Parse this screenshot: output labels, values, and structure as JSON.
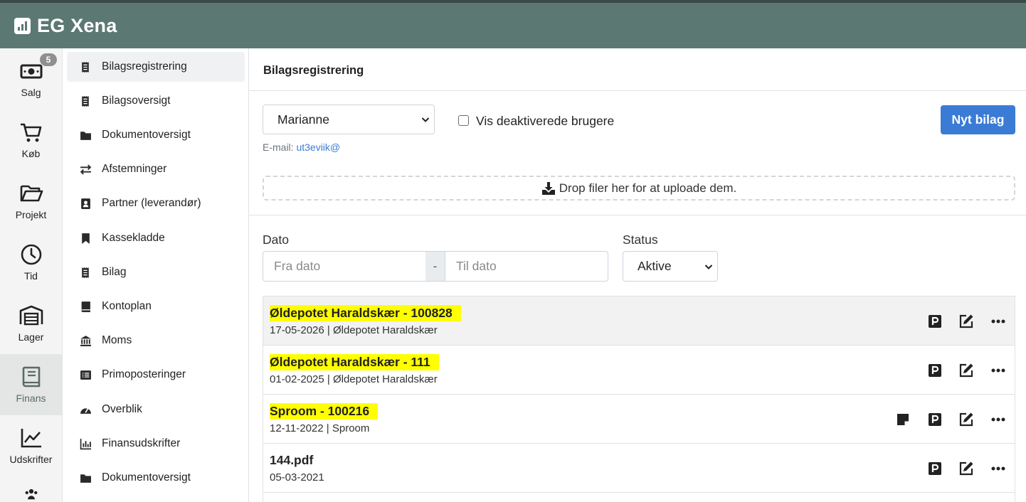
{
  "app": {
    "title": "EG Xena"
  },
  "rail": {
    "badge": "5",
    "items": [
      {
        "label": "Salg",
        "icon": "money-icon"
      },
      {
        "label": "Køb",
        "icon": "cart-icon"
      },
      {
        "label": "Projekt",
        "icon": "folder-open-icon"
      },
      {
        "label": "Tid",
        "icon": "clock-icon"
      },
      {
        "label": "Lager",
        "icon": "warehouse-icon"
      },
      {
        "label": "Finans",
        "icon": "book-icon",
        "active": true
      },
      {
        "label": "Udskrifter",
        "icon": "chart-line-icon"
      }
    ]
  },
  "nav": {
    "items": [
      {
        "label": "Bilagsregistrering",
        "icon": "receipt-icon",
        "active": true
      },
      {
        "label": "Bilagsoversigt",
        "icon": "receipt-icon"
      },
      {
        "label": "Dokumentoversigt",
        "icon": "folder-icon"
      },
      {
        "label": "Afstemninger",
        "icon": "exchange-icon"
      },
      {
        "label": "Partner (leverandør)",
        "icon": "contact-icon"
      },
      {
        "label": "Kassekladde",
        "icon": "bookmark-icon"
      },
      {
        "label": "Bilag",
        "icon": "receipt-icon"
      },
      {
        "label": "Kontoplan",
        "icon": "book-icon"
      },
      {
        "label": "Moms",
        "icon": "bank-icon"
      },
      {
        "label": "Primoposteringer",
        "icon": "list-icon"
      },
      {
        "label": "Overblik",
        "icon": "gauge-icon"
      },
      {
        "label": "Finansudskrifter",
        "icon": "bar-chart-icon"
      },
      {
        "label": "Dokumentoversigt",
        "icon": "folder-icon"
      }
    ]
  },
  "main": {
    "title": "Bilagsregistrering",
    "user_select": "Marianne",
    "show_deactivated_label": "Vis deaktiverede brugere",
    "email_label": "E-mail:",
    "email_value": "ut3eviik@",
    "new_button": "Nyt bilag",
    "dropzone_text": "Drop filer her for at uploade dem.",
    "date_label": "Dato",
    "from_placeholder": "Fra dato",
    "date_separator": "-",
    "to_placeholder": "Til dato",
    "status_label": "Status",
    "status_value": "Aktive"
  },
  "vouchers": [
    {
      "title": "Øldepotet Haraldskær - 100828",
      "subtitle": "17-05-2026 | Øldepotet Haraldskær",
      "highlighted": true,
      "note": false
    },
    {
      "title": "Øldepotet Haraldskær - 111",
      "subtitle": "01-02-2025 | Øldepotet Haraldskær",
      "highlighted": true,
      "note": false
    },
    {
      "title": "Sproom - 100216",
      "subtitle": "12-11-2022 | Sproom",
      "highlighted": true,
      "note": true
    },
    {
      "title": "144.pdf",
      "subtitle": "05-03-2021",
      "highlighted": false,
      "note": false
    }
  ]
}
